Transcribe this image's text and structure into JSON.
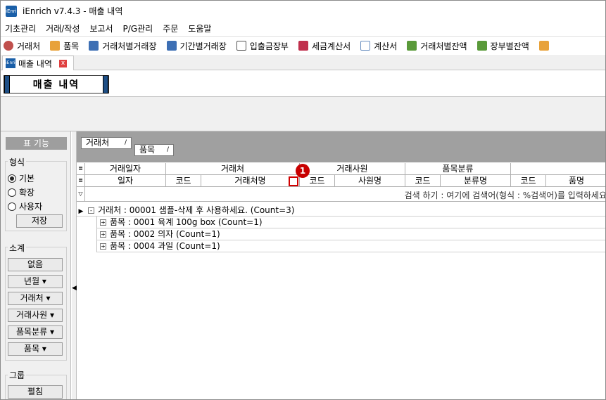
{
  "window": {
    "title": "iEnrich v7.4.3 - 매출 내역",
    "app_icon": "iEnrich"
  },
  "menu": [
    "기초관리",
    "거래/작성",
    "보고서",
    "P/G관리",
    "주문",
    "도움말"
  ],
  "toolbar": [
    {
      "label": "거래처",
      "icon": "person-icon",
      "color": "#c0504d"
    },
    {
      "label": "품목",
      "icon": "box-icon",
      "color": "#e8a23a"
    },
    {
      "label": "거래처별거래장",
      "icon": "ledger-icon",
      "color": "#3d6fb4"
    },
    {
      "label": "기간별거래장",
      "icon": "ledger-icon",
      "color": "#3d6fb4"
    },
    {
      "label": "입출금장부",
      "icon": "book-icon",
      "color": "#555555"
    },
    {
      "label": "세금계산서",
      "icon": "invoice-icon",
      "color": "#c0304d"
    },
    {
      "label": "계산서",
      "icon": "invoice-icon",
      "color": "#6a8fc0"
    },
    {
      "label": "거래처별잔액",
      "icon": "money-icon",
      "color": "#5a9a3a"
    },
    {
      "label": "장부별잔액",
      "icon": "money-icon",
      "color": "#5a9a3a"
    }
  ],
  "doc_tab": {
    "label": "매출 내역",
    "close": "x"
  },
  "page_title": "매출 내역",
  "left_panel": {
    "title": "표 기능",
    "format_label": "형식",
    "format_options": [
      {
        "label": "기본",
        "selected": true
      },
      {
        "label": "확장",
        "selected": false
      },
      {
        "label": "사용자",
        "selected": false
      }
    ],
    "save_button": "저장",
    "subtotal_label": "소계",
    "subtotal_buttons": [
      "없음",
      "년월 ▾",
      "거래처 ▾",
      "거래사원 ▾",
      "품목분류 ▾",
      "품목 ▾"
    ],
    "group_label": "그룹",
    "expand_button": "펼침"
  },
  "grid": {
    "group_chips": [
      {
        "label": "거래처",
        "sort": "/"
      },
      {
        "label": "품목",
        "sort": "/"
      }
    ],
    "header_top": [
      "거래일자",
      "거래처",
      "거래사원",
      "품목분류",
      ""
    ],
    "header_bottom": [
      "일자",
      "코드",
      "거래처명",
      "코드",
      "사원명",
      "코드",
      "분류명",
      "코드",
      "품명"
    ],
    "filter_hint": "검색 하기 : 여기에 검색어(형식 : %검색어)를 입력하세요",
    "rows": [
      {
        "text": "거래처 : 00001 샘플-삭제 후 사용하세요. (Count=3)",
        "expander": "-",
        "level": 0
      },
      {
        "text": "품목 : 0001 육계 100g box (Count=1)",
        "expander": "+",
        "level": 1
      },
      {
        "text": "품목 : 0002 의자   (Count=1)",
        "expander": "+",
        "level": 1
      },
      {
        "text": "품목 : 0004 과일   (Count=1)",
        "expander": "+",
        "level": 1
      }
    ]
  },
  "annotation_marker": "1"
}
